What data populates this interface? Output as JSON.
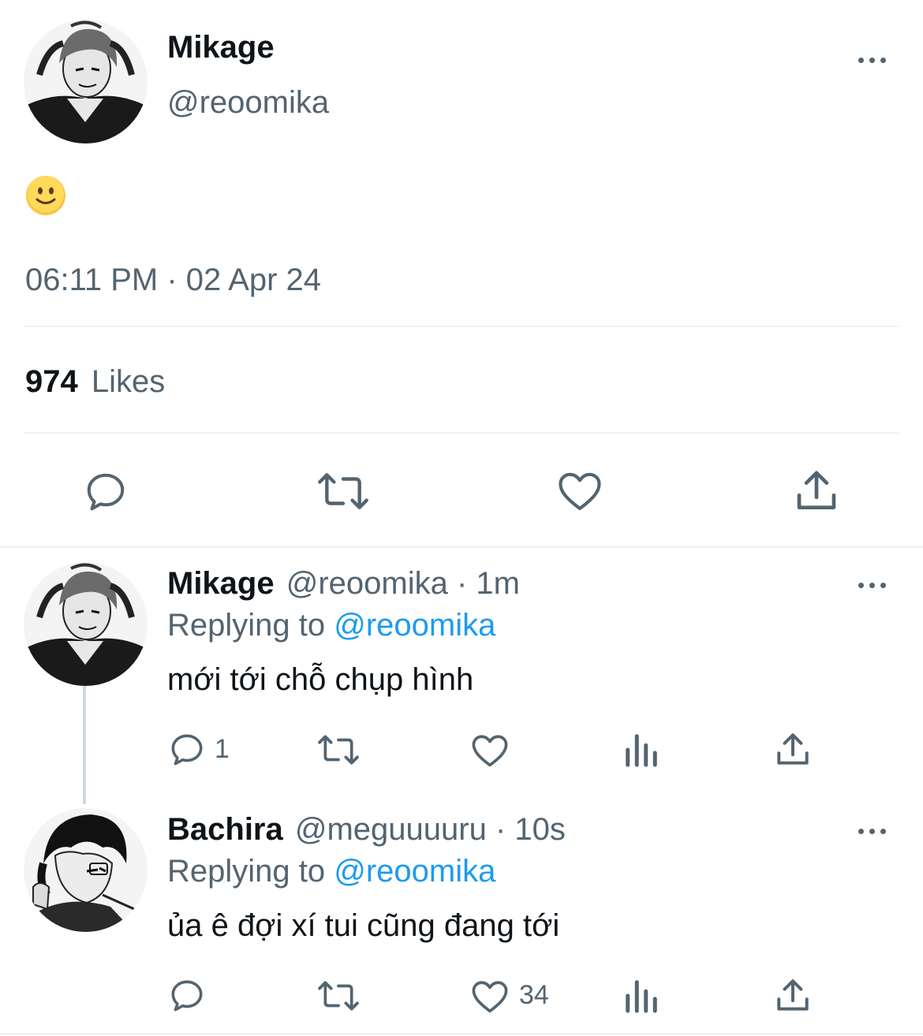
{
  "main_tweet": {
    "author_name": "Mikage",
    "handle": "@reoomika",
    "emoji": "🙂",
    "timestamp": "06:11 PM · 02 Apr 24",
    "likes_count": "974",
    "likes_label": "Likes"
  },
  "replies": [
    {
      "author_name": "Mikage",
      "handle_time": "@reoomika · 1m",
      "replying_prefix": "Replying to ",
      "replying_handle": "@reoomika",
      "text": "mới tới chỗ chụp hình",
      "reply_count": "1",
      "like_count": ""
    },
    {
      "author_name": "Bachira",
      "handle_time": "@meguuuuru · 10s",
      "replying_prefix": "Replying to ",
      "replying_handle": "@reoomika",
      "text": "ủa ê đợi xí tui cũng đang tới",
      "reply_count": "",
      "like_count": "34"
    }
  ],
  "colors": {
    "text": "#0f1419",
    "secondary": "#536471",
    "link": "#1d9bf0",
    "divider": "#eff3f4"
  },
  "icons": [
    "more-icon",
    "reply-icon",
    "retweet-icon",
    "like-icon",
    "share-icon",
    "analytics-icon",
    "avatar-mikage",
    "avatar-bachira"
  ]
}
